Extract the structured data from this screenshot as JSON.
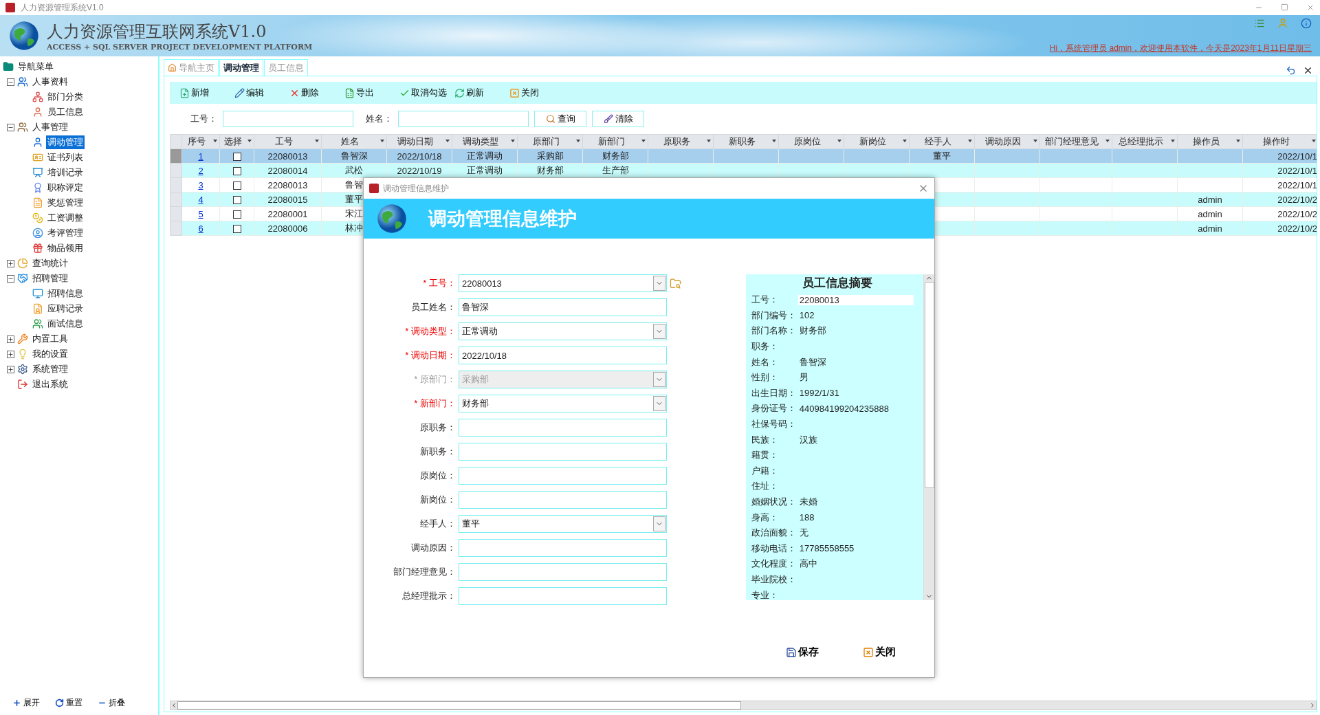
{
  "window": {
    "title": "人力资源管理系统V1.0"
  },
  "banner": {
    "title": "人力资源管理互联网系统V1.0",
    "subtitle": "ACCESS + SQL SERVER PROJECT DEVELOPMENT PLATFORM",
    "welcome": "Hi，系统管理员 admin，欢迎使用本软件，今天是2023年1月11日星期三"
  },
  "sidebar": {
    "title": "导航菜单",
    "items": [
      {
        "label": "人事资料",
        "expanded": true,
        "children": [
          {
            "label": "部门分类",
            "selected": false
          },
          {
            "label": "员工信息",
            "selected": false
          }
        ]
      },
      {
        "label": "人事管理",
        "expanded": true,
        "children": [
          {
            "label": "调动管理",
            "selected": true
          },
          {
            "label": "证书列表",
            "selected": false
          },
          {
            "label": "培训记录",
            "selected": false
          },
          {
            "label": "职称评定",
            "selected": false
          },
          {
            "label": "奖惩管理",
            "selected": false
          },
          {
            "label": "工资调整",
            "selected": false
          },
          {
            "label": "考评管理",
            "selected": false
          },
          {
            "label": "物品领用",
            "selected": false
          }
        ]
      },
      {
        "label": "查询统计",
        "expanded": false
      },
      {
        "label": "招聘管理",
        "expanded": true,
        "children": [
          {
            "label": "招聘信息",
            "selected": false
          },
          {
            "label": "应聘记录",
            "selected": false
          },
          {
            "label": "面试信息",
            "selected": false
          }
        ]
      },
      {
        "label": "内置工具",
        "expanded": false
      },
      {
        "label": "我的设置",
        "expanded": false
      },
      {
        "label": "系统管理",
        "expanded": false
      },
      {
        "label": "退出系统"
      }
    ],
    "footer": [
      "展开",
      "重置",
      "折叠"
    ]
  },
  "tabs": [
    {
      "label": "导航主页",
      "selected": false
    },
    {
      "label": "调动管理",
      "selected": true
    },
    {
      "label": "员工信息",
      "selected": false
    }
  ],
  "toolbar": [
    "新增",
    "编辑",
    "删除",
    "导出",
    "取消勾选",
    "刷新",
    "关闭"
  ],
  "search": {
    "fields": [
      {
        "label": "工号："
      },
      {
        "label": "姓名："
      }
    ],
    "buttons": [
      "查询",
      "清除"
    ]
  },
  "table": {
    "columns": [
      {
        "label": "序号"
      },
      {
        "label": "选择"
      },
      {
        "label": "工号"
      },
      {
        "label": "姓名"
      },
      {
        "label": "调动日期"
      },
      {
        "label": "调动类型"
      },
      {
        "label": "原部门"
      },
      {
        "label": "新部门"
      },
      {
        "label": "原职务"
      },
      {
        "label": "新职务"
      },
      {
        "label": "原岗位"
      },
      {
        "label": "新岗位"
      },
      {
        "label": "经手人"
      },
      {
        "label": "调动原因"
      },
      {
        "label": "部门经理意见"
      },
      {
        "label": "总经理批示"
      },
      {
        "label": "操作员"
      },
      {
        "label": "操作时"
      }
    ],
    "rows": [
      {
        "no": "1",
        "checked": false,
        "selected": true,
        "emp_id": "22080013",
        "name": "鲁智深",
        "date": "2022/10/18",
        "type": "正常调动",
        "old_dept": "采购部",
        "new_dept": "财务部",
        "handler": "董平",
        "op_time": "2022/10/1"
      },
      {
        "no": "2",
        "checked": false,
        "selected": false,
        "emp_id": "22080014",
        "name": "武松",
        "date": "2022/10/19",
        "type": "正常调动",
        "old_dept": "财务部",
        "new_dept": "生产部",
        "op_time": "2022/10/1"
      },
      {
        "no": "3",
        "checked": false,
        "selected": false,
        "emp_id": "22080013",
        "name": "鲁智",
        "op_time": "2022/10/1"
      },
      {
        "no": "4",
        "checked": false,
        "selected": false,
        "emp_id": "22080015",
        "name": "董平",
        "operator": "admin",
        "op_time": "2022/10/2"
      },
      {
        "no": "5",
        "checked": false,
        "selected": false,
        "emp_id": "22080001",
        "name": "宋江",
        "operator": "admin",
        "op_time": "2022/10/2"
      },
      {
        "no": "6",
        "checked": false,
        "selected": false,
        "emp_id": "22080006",
        "name": "林冲",
        "operator": "admin",
        "op_time": "2022/10/2"
      }
    ]
  },
  "dialog": {
    "window_title": "调动管理信息维护",
    "heading": "调动管理信息维护",
    "fields": [
      {
        "label": "* 工号：",
        "required": true,
        "disabled": false,
        "kind": "combo",
        "value": "22080013",
        "lookup": true
      },
      {
        "label": "员工姓名：",
        "required": false,
        "disabled": false,
        "kind": "text",
        "value": "鲁智深"
      },
      {
        "label": "* 调动类型：",
        "required": true,
        "disabled": false,
        "kind": "combo",
        "value": "正常调动"
      },
      {
        "label": "* 调动日期：",
        "required": true,
        "disabled": false,
        "kind": "text",
        "value": "2022/10/18"
      },
      {
        "label": "* 原部门：",
        "required": true,
        "disabled": true,
        "kind": "combo",
        "value": "采购部"
      },
      {
        "label": "* 新部门：",
        "required": true,
        "disabled": false,
        "kind": "combo",
        "value": "财务部"
      },
      {
        "label": "原职务：",
        "required": false,
        "disabled": false,
        "kind": "text"
      },
      {
        "label": "新职务：",
        "required": false,
        "disabled": false,
        "kind": "text"
      },
      {
        "label": "原岗位：",
        "required": false,
        "disabled": false,
        "kind": "text"
      },
      {
        "label": "新岗位：",
        "required": false,
        "disabled": false,
        "kind": "text"
      },
      {
        "label": "经手人：",
        "required": false,
        "disabled": false,
        "kind": "combo",
        "value": "董平"
      },
      {
        "label": "调动原因：",
        "required": false,
        "disabled": false,
        "kind": "text"
      },
      {
        "label": "部门经理意见：",
        "required": false,
        "disabled": false,
        "kind": "text"
      },
      {
        "label": "总经理批示：",
        "required": false,
        "disabled": false,
        "kind": "text"
      }
    ],
    "summary": {
      "title": "员工信息摘要",
      "items": [
        {
          "label": "工号：",
          "value": "22080013",
          "boxed": true
        },
        {
          "label": "部门编号：",
          "value": "102"
        },
        {
          "label": "部门名称：",
          "value": "财务部"
        },
        {
          "label": "职务："
        },
        {
          "label": "姓名：",
          "value": "鲁智深"
        },
        {
          "label": "性别：",
          "value": "男"
        },
        {
          "label": "出生日期：",
          "value": "1992/1/31"
        },
        {
          "label": "身份证号：",
          "value": "440984199204235888"
        },
        {
          "label": "社保号码："
        },
        {
          "label": "民族：",
          "value": "汉族"
        },
        {
          "label": "籍贯："
        },
        {
          "label": "户籍："
        },
        {
          "label": "住址："
        },
        {
          "label": "婚姻状况：",
          "value": "未婚"
        },
        {
          "label": "身高：",
          "value": "188"
        },
        {
          "label": "政治面貌：",
          "value": "无"
        },
        {
          "label": "移动电话：",
          "value": "17785558555"
        },
        {
          "label": "文化程度：",
          "value": "高中"
        },
        {
          "label": "毕业院校："
        },
        {
          "label": "专业："
        }
      ]
    },
    "buttons": [
      "保存",
      "关闭"
    ]
  }
}
